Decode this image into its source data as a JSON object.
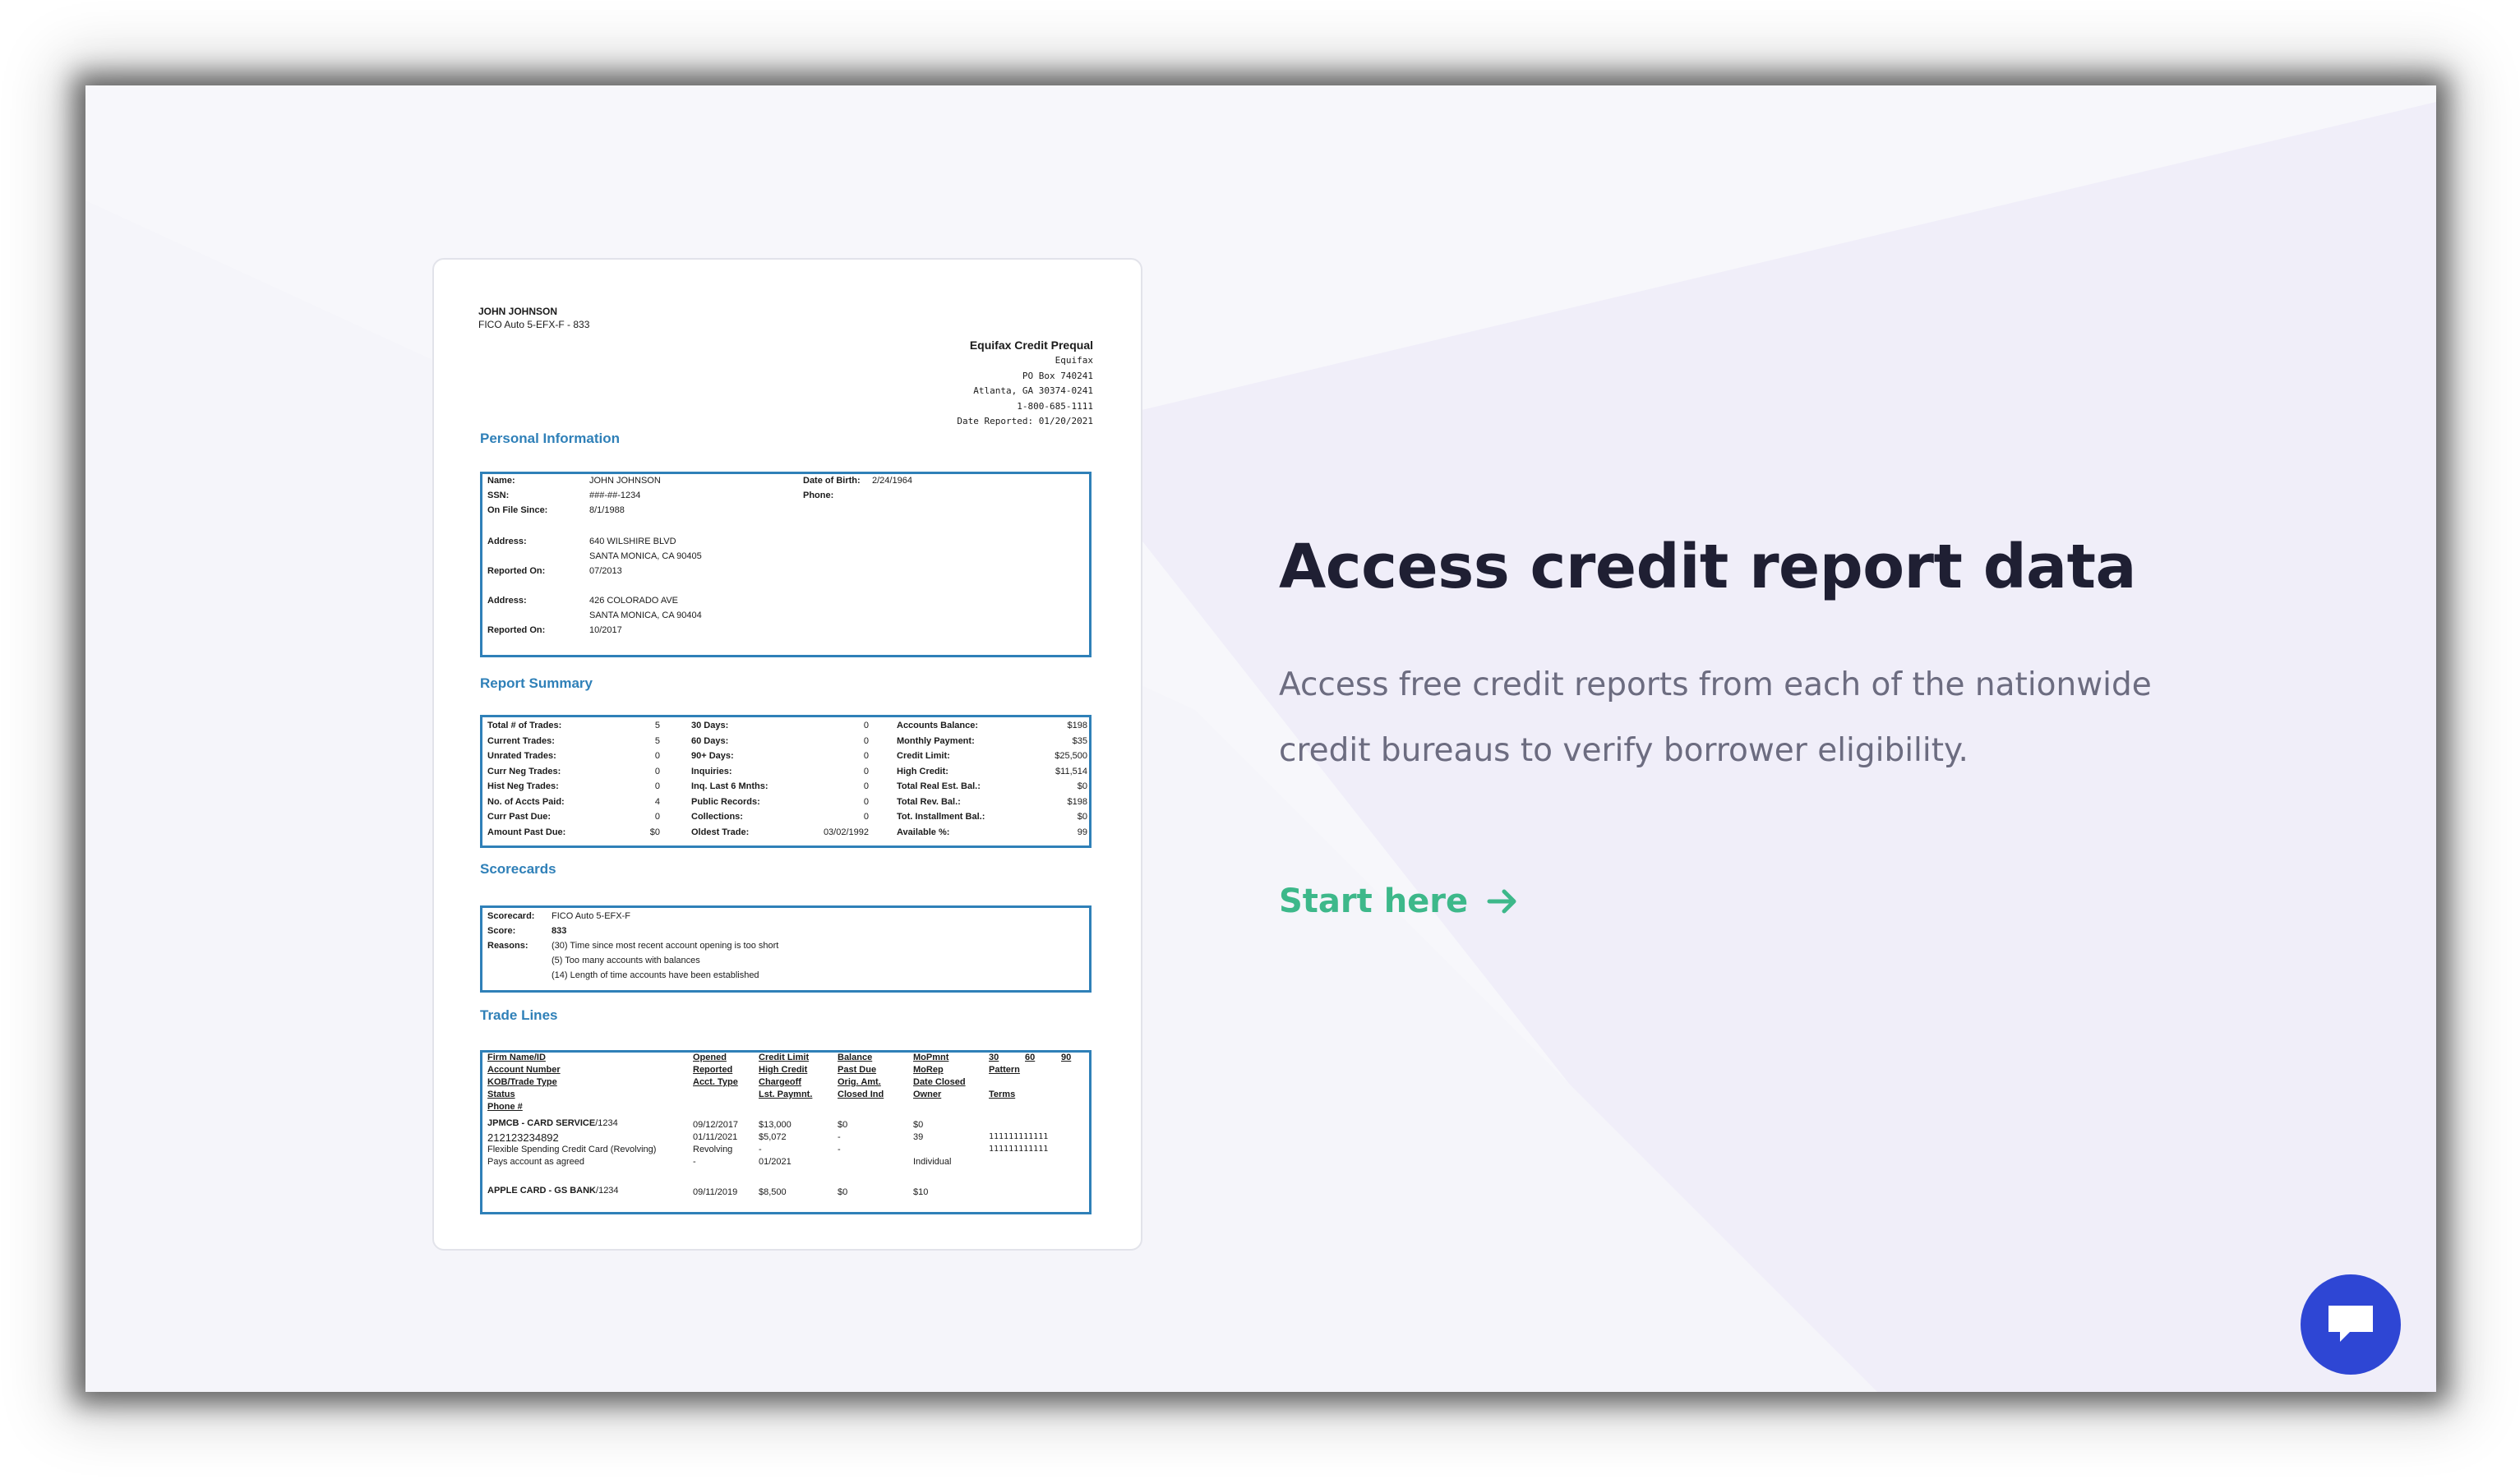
{
  "colors": {
    "accent": "#3db88a",
    "doc_blue": "#2f80b8",
    "chat": "#2e46d4",
    "headline": "#1f1f33",
    "subtext": "#6c6c80"
  },
  "doc": {
    "name": "JOHN JOHNSON",
    "model": "FICO Auto 5-EFX-F - 833",
    "bureau": {
      "title": "Equifax Credit Prequal",
      "name": "Equifax",
      "box": "PO Box 740241",
      "city": "Atlanta, GA 30374-0241",
      "phone": "1-800-685-1111",
      "reported": "Date Reported: 01/20/2021"
    },
    "personal": {
      "title": "Personal Information",
      "name_label": "Name:",
      "name": "JOHN JOHNSON",
      "ssn_label": "SSN:",
      "ssn": "###-##-1234",
      "since_label": "On File Since:",
      "since": "8/1/1988",
      "dob_label": "Date of Birth:",
      "dob": "2/24/1964",
      "phone_label": "Phone:",
      "addr_label": "Address:",
      "addr1_line1": "640 WILSHIRE BLVD",
      "addr1_line2": "SANTA MONICA, CA 90405",
      "rep_label": "Reported On:",
      "rep1": "07/2013",
      "addr2_line1": "426 COLORADO AVE",
      "addr2_line2": "SANTA MONICA, CA 90404",
      "rep2": "10/2017"
    },
    "summary": {
      "title": "Report Summary",
      "col1": [
        {
          "label": "Total # of Trades:",
          "value": "5"
        },
        {
          "label": "Current Trades:",
          "value": "5"
        },
        {
          "label": "Unrated Trades:",
          "value": "0"
        },
        {
          "label": "Curr Neg Trades:",
          "value": "0"
        },
        {
          "label": "Hist Neg Trades:",
          "value": "0"
        },
        {
          "label": "No. of Accts Paid:",
          "value": "4"
        },
        {
          "label": "Curr Past Due:",
          "value": "0"
        },
        {
          "label": "Amount Past Due:",
          "value": "$0"
        }
      ],
      "col2": [
        {
          "label": "30 Days:",
          "value": "0"
        },
        {
          "label": "60 Days:",
          "value": "0"
        },
        {
          "label": "90+ Days:",
          "value": "0"
        },
        {
          "label": "Inquiries:",
          "value": "0"
        },
        {
          "label": "Inq. Last 6 Mnths:",
          "value": "0"
        },
        {
          "label": "Public Records:",
          "value": "0"
        },
        {
          "label": "Collections:",
          "value": "0"
        },
        {
          "label": "Oldest Trade:",
          "value": "03/02/1992"
        }
      ],
      "col3": [
        {
          "label": "Accounts Balance:",
          "value": "$198"
        },
        {
          "label": "Monthly Payment:",
          "value": "$35"
        },
        {
          "label": "Credit Limit:",
          "value": "$25,500"
        },
        {
          "label": "High Credit:",
          "value": "$11,514"
        },
        {
          "label": "Total Real Est. Bal.:",
          "value": "$0"
        },
        {
          "label": "Total Rev. Bal.:",
          "value": "$198"
        },
        {
          "label": "Tot. Installment Bal.:",
          "value": "$0"
        },
        {
          "label": "Available %:",
          "value": "99"
        }
      ]
    },
    "scorecards": {
      "title": "Scorecards",
      "card_label": "Scorecard:",
      "card": "FICO Auto 5-EFX-F",
      "score_label": "Score:",
      "score": "833",
      "reasons_label": "Reasons:",
      "reasons": [
        "(30) Time since most recent account opening is too short",
        "(5) Too many accounts with balances",
        "(14) Length of time accounts have been established"
      ]
    },
    "trades": {
      "title": "Trade Lines",
      "h1": [
        "Firm Name/ID",
        "Account Number",
        "KOB/Trade Type",
        "Status",
        "Phone #"
      ],
      "h2": [
        "Opened",
        "Reported",
        "Acct. Type"
      ],
      "h3": [
        "Credit Limit",
        "High Credit",
        "Chargeoff",
        "Lst. Paymnt."
      ],
      "h4": [
        "Balance",
        "Past Due",
        "Orig. Amt.",
        "Closed Ind"
      ],
      "h5": [
        "MoPmnt",
        "MoRep",
        "Date Closed",
        "Owner"
      ],
      "h6a": "30",
      "h6b": "60",
      "h6c": "90",
      "h6d": "Pattern",
      "h6e": "Terms",
      "row1": {
        "firm_bold": "JPMCB - CARD SERVICE",
        "firm_id": "/1234",
        "acct": "212123234892",
        "kob": "Flexible Spending Credit Card (Revolving)",
        "status": "Pays account as agreed",
        "d1": "09/12/2017",
        "d2": "01/11/2021",
        "d3": "Revolving",
        "d4": "-",
        "c1": "$13,000",
        "c2": "$5,072",
        "c3": "-",
        "c4": "01/2021",
        "b1": "$0",
        "b2": "-",
        "b3": "-",
        "m1": "$0",
        "m2": "39",
        "m4": "Individual",
        "p1": "111111111111",
        "p2": "111111111111"
      },
      "row2": {
        "firm_bold": "APPLE CARD - GS BANK",
        "firm_id": "/1234",
        "d1": "09/11/2019",
        "c1": "$8,500",
        "b1": "$0",
        "m1": "$10"
      }
    }
  },
  "hero": {
    "headline": "Access credit report data",
    "subtext": "Access free credit reports from each of the nationwide credit bureaus to verify borrower eligibility.",
    "cta": "Start here"
  },
  "icons": {
    "cta": "arrow-right-icon",
    "chat": "chat-bubble-icon"
  }
}
